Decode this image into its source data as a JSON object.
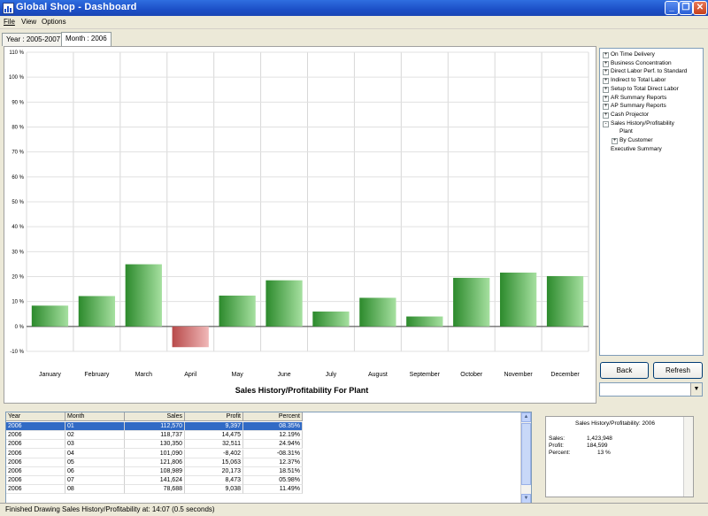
{
  "window": {
    "title": "Global Shop - Dashboard"
  },
  "menu": [
    "File",
    "View",
    "Options"
  ],
  "tabs": [
    "Year : 2005-2007",
    "Month : 2006"
  ],
  "chart_data": {
    "type": "bar",
    "title": "Sales History/Profitability For Plant",
    "categories": [
      "January",
      "February",
      "March",
      "April",
      "May",
      "June",
      "July",
      "August",
      "September",
      "October",
      "November",
      "December"
    ],
    "values": [
      8.35,
      12.19,
      24.94,
      -8.31,
      12.37,
      18.51,
      5.98,
      11.49,
      4.0,
      19.5,
      21.6,
      20.2
    ],
    "yticks": [
      "110 %",
      "100 %",
      "90 %",
      "80 %",
      "70 %",
      "60 %",
      "50 %",
      "40 %",
      "30 %",
      "20 %",
      "10 %",
      "0 %",
      "-10 %"
    ],
    "ylim": [
      -10,
      110
    ],
    "colors": {
      "positive": "#3fa33f",
      "negative": "#c86060"
    }
  },
  "tree": {
    "items": [
      {
        "label": "On Time Delivery",
        "exp": "+",
        "level": 0
      },
      {
        "label": "Business Concentration",
        "exp": "+",
        "level": 0
      },
      {
        "label": "Direct Labor Perf. to Standard",
        "exp": "+",
        "level": 0
      },
      {
        "label": "Indirect to Total Labor",
        "exp": "+",
        "level": 0
      },
      {
        "label": "Setup to Total Direct Labor",
        "exp": "+",
        "level": 0
      },
      {
        "label": "AR Summary Reports",
        "exp": "+",
        "level": 0
      },
      {
        "label": "AP Summary Reports",
        "exp": "+",
        "level": 0
      },
      {
        "label": "Cash Projector",
        "exp": "+",
        "level": 0
      },
      {
        "label": "Sales History/Profitability",
        "exp": "-",
        "level": 0
      },
      {
        "label": "Plant",
        "exp": "",
        "level": 1
      },
      {
        "label": "By Customer",
        "exp": "+",
        "level": 1
      },
      {
        "label": "Executive Summary",
        "exp": "",
        "level": 0
      }
    ]
  },
  "buttons": {
    "back": "Back",
    "refresh": "Refresh"
  },
  "combo": {
    "value": ""
  },
  "grid": {
    "columns": [
      "Year",
      "Month",
      "Sales",
      "Profit",
      "Percent"
    ],
    "rows": [
      [
        "2006",
        "01",
        "112,570",
        "9,397",
        "08.35%"
      ],
      [
        "2006",
        "02",
        "118,737",
        "14,475",
        "12.19%"
      ],
      [
        "2006",
        "03",
        "130,350",
        "32,511",
        "24.94%"
      ],
      [
        "2006",
        "04",
        "101,090",
        "-8,402",
        "-08.31%"
      ],
      [
        "2006",
        "05",
        "121,806",
        "15,063",
        "12.37%"
      ],
      [
        "2006",
        "06",
        "108,989",
        "20,173",
        "18.51%"
      ],
      [
        "2006",
        "07",
        "141,624",
        "8,473",
        "05.98%"
      ],
      [
        "2006",
        "08",
        "78,688",
        "9,038",
        "11.49%"
      ]
    ]
  },
  "summary": {
    "title": "Sales History/Profitability: 2006",
    "sales_label": "Sales:",
    "sales_value": "1,423,948",
    "profit_label": "Profit:",
    "profit_value": "184,599",
    "percent_label": "Percent:",
    "percent_value": "13 %"
  },
  "status": "Finished Drawing Sales History/Profitability at: 14:07 (0.5 seconds)"
}
